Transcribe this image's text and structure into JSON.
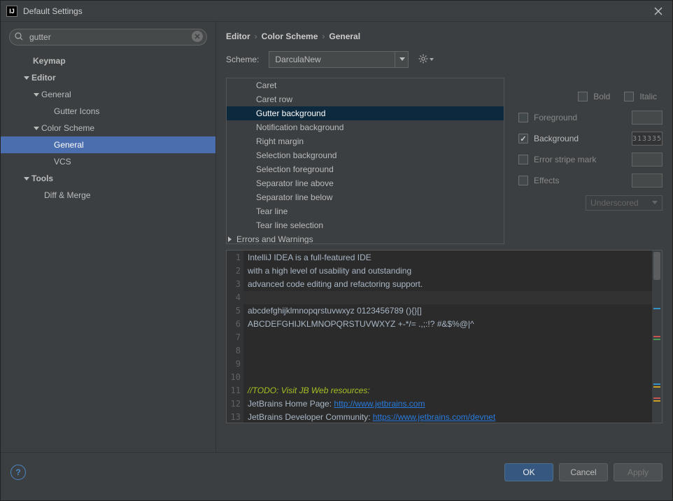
{
  "window": {
    "title": "Default Settings"
  },
  "search": {
    "value": "gutter"
  },
  "tree": {
    "keymap": "Keymap",
    "editor": "Editor",
    "general": "General",
    "gutter_icons": "Gutter Icons",
    "color_scheme": "Color Scheme",
    "cs_general": "General",
    "vcs": "VCS",
    "tools": "Tools",
    "diff_merge": "Diff & Merge"
  },
  "breadcrumb": {
    "a": "Editor",
    "b": "Color Scheme",
    "c": "General"
  },
  "scheme": {
    "label": "Scheme:",
    "value": "DarculaNew"
  },
  "options": {
    "caret": "Caret",
    "caret_row": "Caret row",
    "gutter_bg": "Gutter background",
    "notif_bg": "Notification background",
    "right_margin": "Right margin",
    "sel_bg": "Selection background",
    "sel_fg": "Selection foreground",
    "sep_above": "Separator line above",
    "sep_below": "Separator line below",
    "tear_line": "Tear line",
    "tear_line_sel": "Tear line selection",
    "errors_warnings": "Errors and Warnings"
  },
  "props": {
    "bold": "Bold",
    "italic": "Italic",
    "foreground": "Foreground",
    "background": "Background",
    "background_value": "313335",
    "error_stripe": "Error stripe mark",
    "effects": "Effects",
    "effects_type": "Underscored"
  },
  "preview": {
    "l1": "IntelliJ IDEA is a full-featured IDE",
    "l2": "with a high level of usability and outstanding",
    "l3": "advanced code editing and refactoring support.",
    "l5": "abcdefghijklmnopqrstuvwxyz 0123456789 (){}[]",
    "l6": "ABCDEFGHIJKLMNOPQRSTUVWXYZ +-*/= .,;:!? #&$%@|^",
    "l11": "//TODO: Visit JB Web resources:",
    "l12a": "JetBrains Home Page: ",
    "l12b": "http://www.jetbrains.com",
    "l13a": "JetBrains Developer Community: ",
    "l13b": "https://www.jetbrains.com/devnet"
  },
  "buttons": {
    "ok": "OK",
    "cancel": "Cancel",
    "apply": "Apply"
  }
}
